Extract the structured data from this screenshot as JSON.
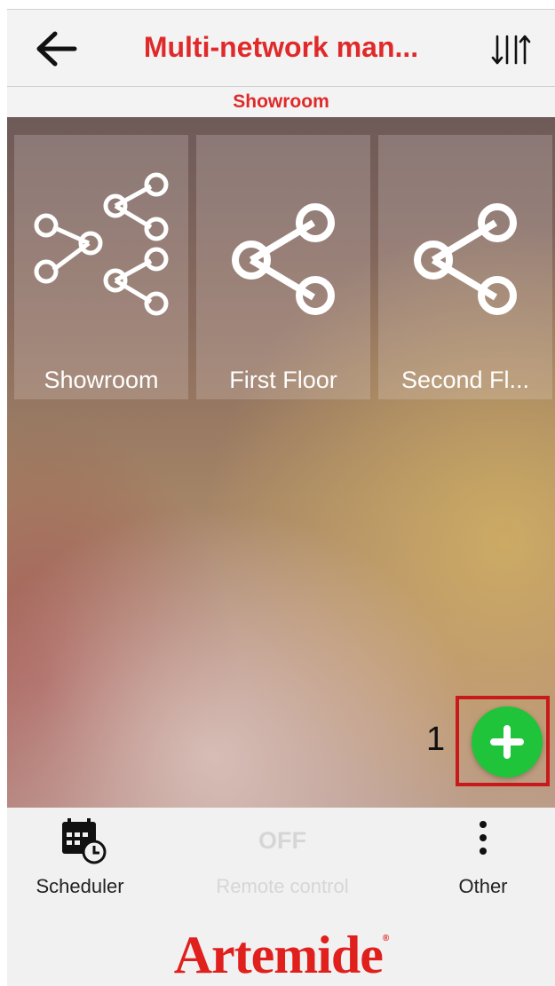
{
  "header": {
    "title": "Multi-network man...",
    "back_icon": "arrow-left-icon",
    "sort_icon": "sort-arrows-icon"
  },
  "subheader": {
    "label": "Showroom"
  },
  "tiles": [
    {
      "label": "Showroom",
      "icon": "multi-network-share-icon"
    },
    {
      "label": "First Floor",
      "icon": "share-network-icon"
    },
    {
      "label": "Second Fl...",
      "icon": "share-network-icon"
    }
  ],
  "fab": {
    "icon": "plus-icon",
    "index_label": "1",
    "highlight_color": "#c81a1a",
    "color": "#20c43a"
  },
  "bottom_nav": {
    "scheduler": {
      "label": "Scheduler",
      "icon": "calendar-clock-icon"
    },
    "remote": {
      "status": "OFF",
      "label": "Remote control"
    },
    "other": {
      "label": "Other",
      "icon": "vertical-dots-icon"
    }
  },
  "brand": {
    "name": "Artemide",
    "mark": "®",
    "color": "#e0201d"
  },
  "colors": {
    "accent": "#e02a2a"
  }
}
